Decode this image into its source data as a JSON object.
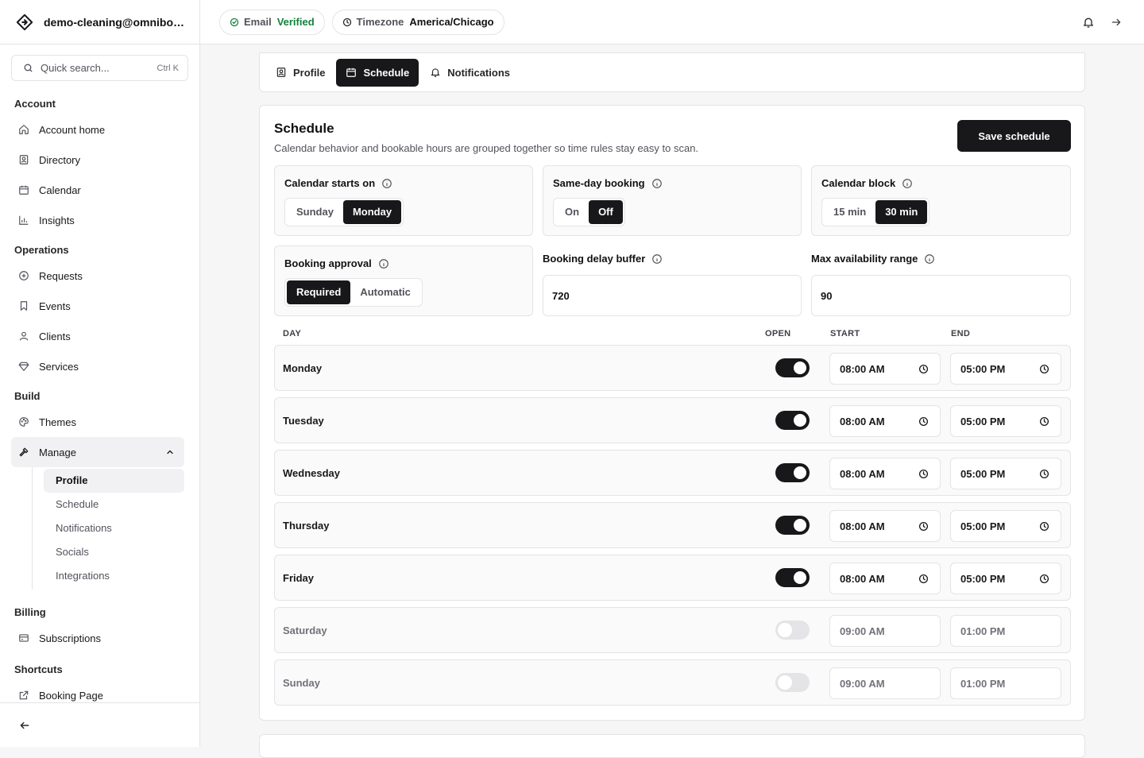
{
  "sidebar": {
    "account_email": "demo-cleaning@omnibooki...",
    "search": {
      "placeholder": "Quick search...",
      "shortcut": "Ctrl K"
    },
    "sections": {
      "account": "Account",
      "operations": "Operations",
      "build": "Build",
      "billing": "Billing",
      "shortcuts": "Shortcuts"
    },
    "items": {
      "account_home": "Account home",
      "directory": "Directory",
      "calendar": "Calendar",
      "insights": "Insights",
      "requests": "Requests",
      "events": "Events",
      "clients": "Clients",
      "services": "Services",
      "themes": "Themes",
      "manage": "Manage",
      "subscriptions": "Subscriptions",
      "booking_page": "Booking Page"
    },
    "manage_sub": [
      "Profile",
      "Schedule",
      "Notifications",
      "Socials",
      "Integrations"
    ]
  },
  "topbar": {
    "email_key": "Email",
    "email_value": "Verified",
    "tz_key": "Timezone",
    "tz_value": "America/Chicago"
  },
  "tabs": [
    "Profile",
    "Schedule",
    "Notifications"
  ],
  "schedule": {
    "title": "Schedule",
    "description": "Calendar behavior and bookable hours are grouped together so time rules stay easy to scan.",
    "save_label": "Save schedule",
    "calendar_starts_on": {
      "label": "Calendar starts on",
      "options": [
        "Sunday",
        "Monday"
      ],
      "selected": "Monday"
    },
    "same_day_booking": {
      "label": "Same-day booking",
      "options": [
        "On",
        "Off"
      ],
      "selected": "Off"
    },
    "calendar_block": {
      "label": "Calendar block",
      "options": [
        "15 min",
        "30 min"
      ],
      "selected": "30 min"
    },
    "booking_approval": {
      "label": "Booking approval",
      "options": [
        "Required",
        "Automatic"
      ],
      "selected": "Required"
    },
    "booking_delay_buffer": {
      "label": "Booking delay buffer",
      "value": "720"
    },
    "max_availability_range": {
      "label": "Max availability range",
      "value": "90"
    },
    "table_headers": {
      "day": "DAY",
      "open": "OPEN",
      "start": "START",
      "end": "END"
    },
    "days": [
      {
        "name": "Monday",
        "open": true,
        "start": "08:00 AM",
        "end": "05:00 PM"
      },
      {
        "name": "Tuesday",
        "open": true,
        "start": "08:00 AM",
        "end": "05:00 PM"
      },
      {
        "name": "Wednesday",
        "open": true,
        "start": "08:00 AM",
        "end": "05:00 PM"
      },
      {
        "name": "Thursday",
        "open": true,
        "start": "08:00 AM",
        "end": "05:00 PM"
      },
      {
        "name": "Friday",
        "open": true,
        "start": "08:00 AM",
        "end": "05:00 PM"
      },
      {
        "name": "Saturday",
        "open": false,
        "start": "09:00 AM",
        "end": "01:00 PM"
      },
      {
        "name": "Sunday",
        "open": false,
        "start": "09:00 AM",
        "end": "01:00 PM"
      }
    ]
  }
}
